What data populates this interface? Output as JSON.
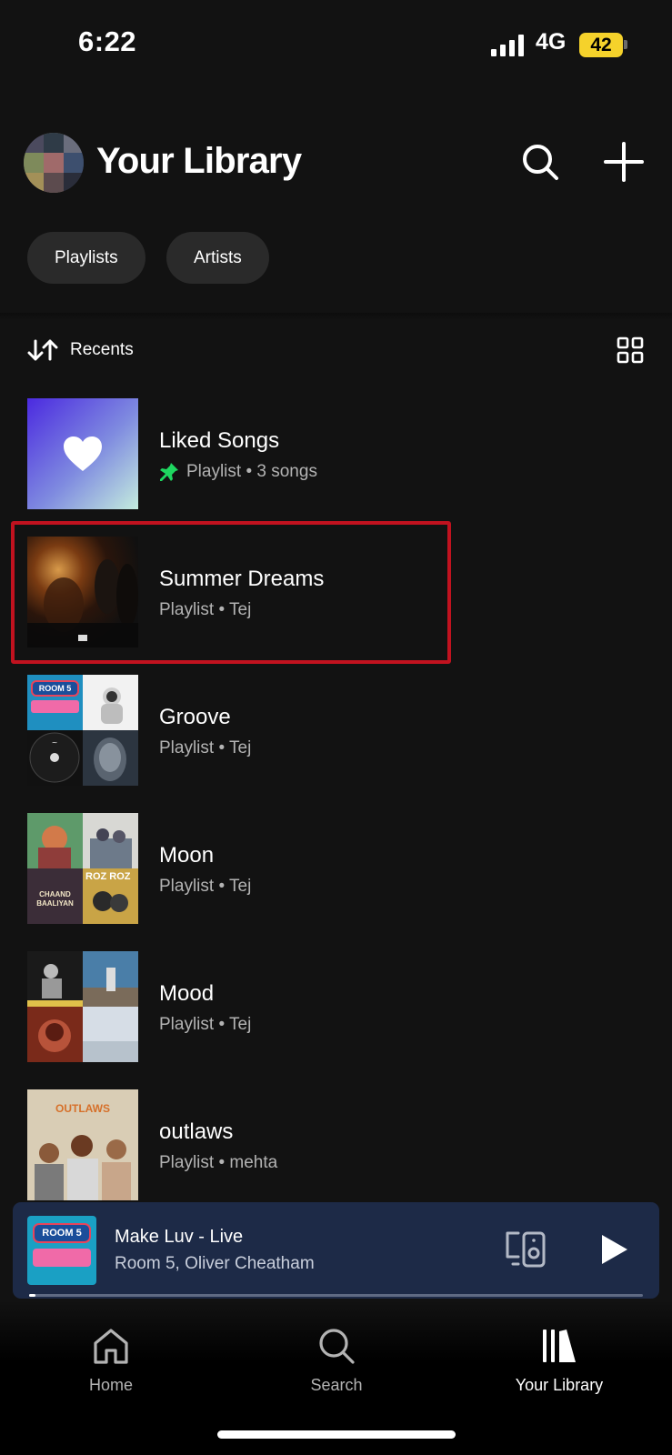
{
  "status_bar": {
    "time": "6:22",
    "network": "4G",
    "battery": "42"
  },
  "header": {
    "title": "Your Library"
  },
  "filters": [
    {
      "label": "Playlists"
    },
    {
      "label": "Artists"
    }
  ],
  "sort": {
    "label": "Recents"
  },
  "library_items": [
    {
      "title": "Liked Songs",
      "subtitle": "Playlist • 3 songs",
      "pinned": true
    },
    {
      "title": "Summer Dreams",
      "subtitle": "Playlist • Tej",
      "highlighted": true
    },
    {
      "title": "Groove",
      "subtitle": "Playlist • Tej"
    },
    {
      "title": "Moon",
      "subtitle": "Playlist • Tej"
    },
    {
      "title": "Mood",
      "subtitle": "Playlist • Tej"
    },
    {
      "title": "outlaws",
      "subtitle": "Playlist • mehta"
    }
  ],
  "thumb_text": {
    "room5": "ROOM 5",
    "roz": "ROZ ROZ",
    "chaand": "CHAAND BAALIYAN",
    "outlaws": "OUTLAWS"
  },
  "now_playing": {
    "title": "Make Luv - Live",
    "artist": "Room 5, Oliver Cheatham",
    "progress_fraction": 0.01
  },
  "nav": [
    {
      "label": "Home",
      "icon": "home-icon"
    },
    {
      "label": "Search",
      "icon": "search-icon"
    },
    {
      "label": "Your Library",
      "icon": "library-icon",
      "active": true
    }
  ],
  "colors": {
    "background": "#121212",
    "accent_green": "#1ed760",
    "highlight_red": "#c1121f",
    "battery_yellow": "#f5d22b",
    "player_bg": "#1d2a47"
  }
}
